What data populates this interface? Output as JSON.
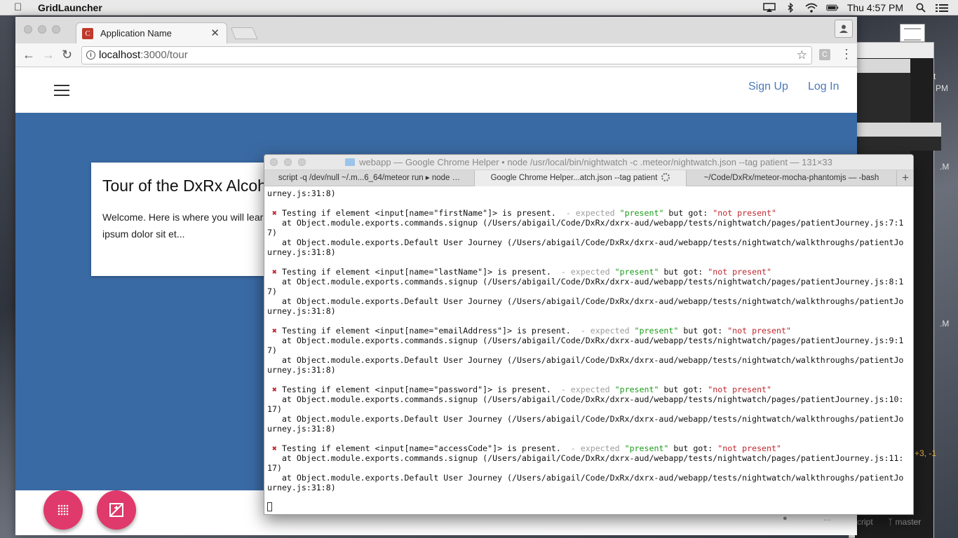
{
  "menubar": {
    "app_name": "GridLauncher",
    "clock": "Thu 4:57 PM"
  },
  "background": {
    "texts": [
      "t",
      "PM",
      ".M",
      ".M",
      "+3, -1",
      "cript",
      "master"
    ]
  },
  "browser": {
    "tab_title": "Application Name",
    "favicon_letter": "C",
    "url_host": "localhost",
    "url_path": ":3000/tour",
    "extension_letter": "C"
  },
  "page": {
    "nav": {
      "signup": "Sign Up",
      "login": "Log In"
    },
    "card": {
      "title": "Tour of the DxRx Alcoholism Recovery Program",
      "body": "Welcome. Here is where you will learn ipsum dolor sit et..."
    },
    "footer_partial": "…"
  },
  "terminal": {
    "title": "webapp — Google Chrome Helper • node /usr/local/bin/nightwatch -c .meteor/nightwatch.json --tag patient — 131×33",
    "tabs": [
      "script -q /dev/null ~/.m...6_64/meteor run ▸ node   …",
      "Google Chrome Helper...atch.json --tag patient",
      "~/Code/DxRx/meteor-mocha-phantomjs — -bash"
    ],
    "top_fragment": "urney.js:31:8)",
    "failures": [
      {
        "message": "Testing if element <input[name=\"firstName\"]> is present.",
        "line1": "   at Object.module.exports.commands.signup (/Users/abigail/Code/DxRx/dxrx-aud/webapp/tests/nightwatch/pages/patientJourney.js:7:1",
        "line2": "7)",
        "line3": "   at Object.module.exports.Default User Journey (/Users/abigail/Code/DxRx/dxrx-aud/webapp/tests/nightwatch/walkthroughs/patientJo",
        "line4": "urney.js:31:8)"
      },
      {
        "message": "Testing if element <input[name=\"lastName\"]> is present.",
        "line1": "   at Object.module.exports.commands.signup (/Users/abigail/Code/DxRx/dxrx-aud/webapp/tests/nightwatch/pages/patientJourney.js:8:1",
        "line2": "7)",
        "line3": "   at Object.module.exports.Default User Journey (/Users/abigail/Code/DxRx/dxrx-aud/webapp/tests/nightwatch/walkthroughs/patientJo",
        "line4": "urney.js:31:8)"
      },
      {
        "message": "Testing if element <input[name=\"emailAddress\"]> is present.",
        "line1": "   at Object.module.exports.commands.signup (/Users/abigail/Code/DxRx/dxrx-aud/webapp/tests/nightwatch/pages/patientJourney.js:9:1",
        "line2": "7)",
        "line3": "   at Object.module.exports.Default User Journey (/Users/abigail/Code/DxRx/dxrx-aud/webapp/tests/nightwatch/walkthroughs/patientJo",
        "line4": "urney.js:31:8)"
      },
      {
        "message": "Testing if element <input[name=\"password\"]> is present.",
        "line1": "   at Object.module.exports.commands.signup (/Users/abigail/Code/DxRx/dxrx-aud/webapp/tests/nightwatch/pages/patientJourney.js:10:",
        "line2": "17)",
        "line3": "   at Object.module.exports.Default User Journey (/Users/abigail/Code/DxRx/dxrx-aud/webapp/tests/nightwatch/walkthroughs/patientJo",
        "line4": "urney.js:31:8)"
      },
      {
        "message": "Testing if element <input[name=\"accessCode\"]> is present.",
        "line1": "   at Object.module.exports.commands.signup (/Users/abigail/Code/DxRx/dxrx-aud/webapp/tests/nightwatch/pages/patientJourney.js:11:",
        "line2": "17)",
        "line3": "   at Object.module.exports.Default User Journey (/Users/abigail/Code/DxRx/dxrx-aud/webapp/tests/nightwatch/walkthroughs/patientJo",
        "line4": "urney.js:31:8)"
      }
    ],
    "fail_mark": "✖",
    "expected_label": "- expected",
    "expected_value": "\"present\"",
    "but_got_label": "but got:",
    "got_value": "\"not present\""
  },
  "colors": {
    "hero_blue": "#3a6aa4",
    "fab_pink": "#e0396b",
    "link_blue": "#4a79b8",
    "fail_red": "#c0262d",
    "pass_green": "#1c9c1c"
  }
}
